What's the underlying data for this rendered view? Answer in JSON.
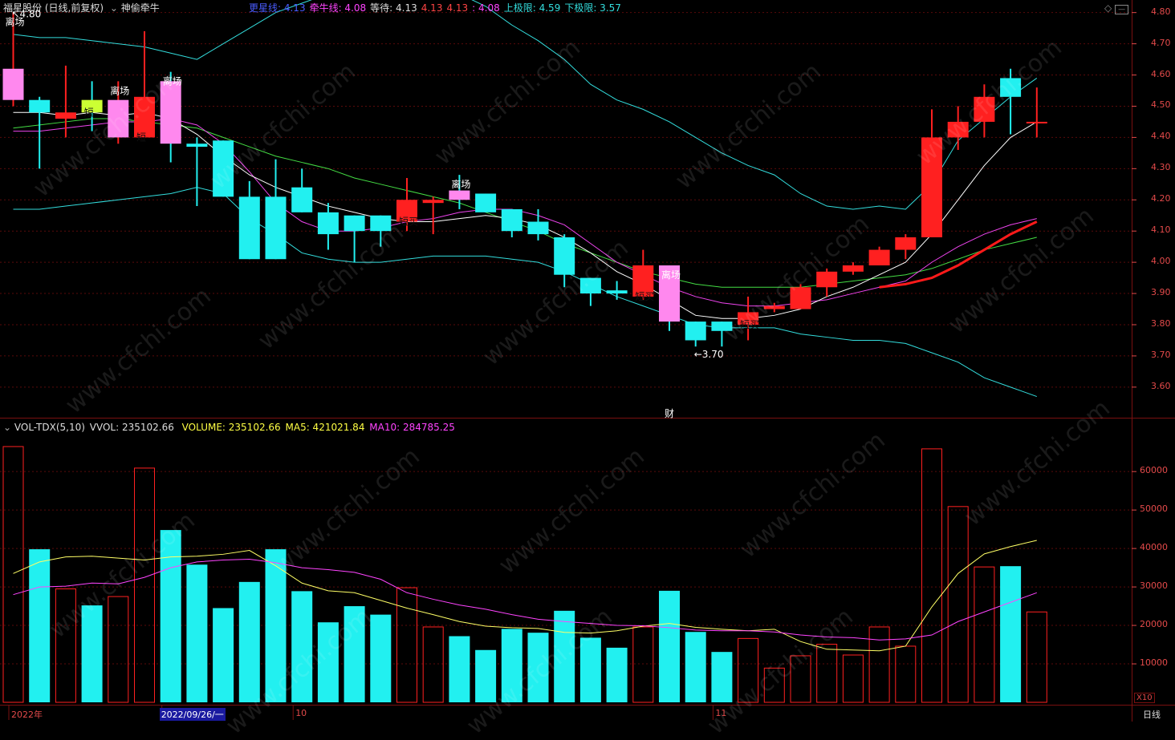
{
  "header": {
    "stock_name": "福星股份",
    "period_label": "(日线,前复权)",
    "indicator_name": "神偷牵牛",
    "items": [
      {
        "label": "更星线:",
        "value": "4.13",
        "color": "#4a5cff"
      },
      {
        "label": "牵牛线:",
        "value": "4.08",
        "color": "#ff44ff"
      },
      {
        "label": "等待:",
        "value": "4.13",
        "color": "#dddddd"
      },
      {
        "label": "",
        "value": "4.13",
        "color": "#ff4444"
      },
      {
        "label": "",
        "value": "4.13",
        "color": "#ff4444"
      },
      {
        "label": "",
        "value": ": 4.08",
        "color": "#ff44ff"
      },
      {
        "label": "上极限:",
        "value": "4.59",
        "color": "#33dddd"
      },
      {
        "label": "下极限:",
        "value": "3.57",
        "color": "#33dddd"
      }
    ]
  },
  "volume_header": {
    "name": "VOL-TDX(5,10)",
    "vvol": "VVOL: 235102.66",
    "volume": "VOLUME: 235102.66",
    "ma5": "MA5: 421021.84",
    "ma10": "MA10: 284785.25"
  },
  "colors": {
    "up": "#ff2020",
    "down": "#22f0f0",
    "ma5": "#ffff66",
    "ma10": "#ff44ff",
    "grid": "#5a0a0a",
    "axis": "#e34a4a"
  },
  "annotations": {
    "high": "4.80",
    "low": "3.70",
    "fin_mark": "财",
    "x10": "X10",
    "period_button": "日线"
  },
  "chart_data": {
    "type": "candlestick",
    "y_ticks": [
      "4.80",
      "4.70",
      "4.60",
      "4.50",
      "4.40",
      "4.30",
      "4.20",
      "4.10",
      "4.00",
      "3.90",
      "3.80",
      "3.70",
      "3.60"
    ],
    "ylim": [
      3.52,
      4.83
    ],
    "vol_ticks": [
      "60000",
      "50000",
      "40000",
      "30000",
      "20000",
      "10000"
    ],
    "vol_ylim": [
      0,
      69000
    ],
    "x_labels": [
      {
        "label": "2022年",
        "index": 0
      },
      {
        "label": "2022/09/26/一",
        "index": 6
      },
      {
        "label": "10",
        "index": 11
      },
      {
        "label": "11",
        "index": 27
      }
    ],
    "candles": [
      [
        4.52,
        4.62,
        4.8,
        4.5
      ],
      [
        4.52,
        4.48,
        4.53,
        4.3
      ],
      [
        4.46,
        4.48,
        4.63,
        4.4
      ],
      [
        4.52,
        4.48,
        4.58,
        4.42
      ],
      [
        4.4,
        4.52,
        4.58,
        4.38
      ],
      [
        4.4,
        4.53,
        4.74,
        4.4
      ],
      [
        4.58,
        4.38,
        4.61,
        4.32
      ],
      [
        4.38,
        4.37,
        4.4,
        4.18
      ],
      [
        4.39,
        4.21,
        4.39,
        4.21
      ],
      [
        4.21,
        4.01,
        4.26,
        4.01
      ],
      [
        4.21,
        4.01,
        4.33,
        4.01
      ],
      [
        4.24,
        4.16,
        4.3,
        4.16
      ],
      [
        4.16,
        4.09,
        4.19,
        4.04
      ],
      [
        4.15,
        4.1,
        4.15,
        4.0
      ],
      [
        4.15,
        4.1,
        4.15,
        4.05
      ],
      [
        4.13,
        4.2,
        4.27,
        4.1
      ],
      [
        4.19,
        4.2,
        4.21,
        4.09
      ],
      [
        4.23,
        4.2,
        4.28,
        4.17
      ],
      [
        4.22,
        4.16,
        4.22,
        4.16
      ],
      [
        4.17,
        4.1,
        4.17,
        4.08
      ],
      [
        4.13,
        4.09,
        4.17,
        4.07
      ],
      [
        4.08,
        3.96,
        4.09,
        3.92
      ],
      [
        3.95,
        3.9,
        3.95,
        3.86
      ],
      [
        3.91,
        3.9,
        3.94,
        3.88
      ],
      [
        3.89,
        3.99,
        4.04,
        3.88
      ],
      [
        3.99,
        3.81,
        3.99,
        3.78
      ],
      [
        3.81,
        3.75,
        3.81,
        3.73
      ],
      [
        3.81,
        3.78,
        3.81,
        3.73
      ],
      [
        3.8,
        3.84,
        3.89,
        3.75
      ],
      [
        3.85,
        3.86,
        3.87,
        3.84
      ],
      [
        3.85,
        3.92,
        3.93,
        3.85
      ],
      [
        3.92,
        3.97,
        3.98,
        3.89
      ],
      [
        3.97,
        3.99,
        4.0,
        3.96
      ],
      [
        3.99,
        4.04,
        4.05,
        3.99
      ],
      [
        4.04,
        4.08,
        4.09,
        4.01
      ],
      [
        4.08,
        4.4,
        4.49,
        4.08
      ],
      [
        4.4,
        4.45,
        4.5,
        4.36
      ],
      [
        4.45,
        4.53,
        4.57,
        4.4
      ],
      [
        4.59,
        4.53,
        4.62,
        4.41
      ],
      [
        4.45,
        4.45,
        4.56,
        4.4
      ]
    ],
    "volume": [
      66500,
      39800,
      29500,
      25200,
      27500,
      60900,
      44800,
      35800,
      24500,
      31300,
      39800,
      28900,
      20800,
      25000,
      22800,
      29800,
      19600,
      17200,
      13600,
      19100,
      18100,
      23800,
      16800,
      14200,
      19600,
      29000,
      18300,
      13100,
      16600,
      8900,
      12100,
      15100,
      12300,
      19600,
      14600,
      65900,
      50900,
      35200,
      35400,
      23500
    ],
    "vol_ma5": [
      33500,
      36500,
      37800,
      38000,
      37500,
      37000,
      37800,
      38000,
      38500,
      39500,
      35500,
      31000,
      29000,
      28500,
      26500,
      24500,
      22800,
      21000,
      19800,
      19400,
      19200,
      18200,
      18000,
      18600,
      19800,
      20500,
      19500,
      19000,
      18600,
      19000,
      15800,
      13800,
      13600,
      13400,
      14600,
      24800,
      33500,
      38600,
      40500,
      42100
    ],
    "vol_ma10": [
      28000,
      30000,
      30200,
      31000,
      30800,
      32500,
      35000,
      36500,
      37000,
      37200,
      36300,
      35000,
      34500,
      33800,
      32000,
      28500,
      26800,
      25300,
      24200,
      22800,
      21600,
      21000,
      20500,
      20000,
      19900,
      19400,
      18800,
      18600,
      18600,
      18300,
      17500,
      17000,
      16800,
      16200,
      16500,
      17500,
      21000,
      23500,
      26000,
      28500
    ],
    "ma_white": [
      4.48,
      4.48,
      4.47,
      4.48,
      4.47,
      4.48,
      4.46,
      4.41,
      4.34,
      4.28,
      4.24,
      4.21,
      4.18,
      4.16,
      4.14,
      4.13,
      4.13,
      4.14,
      4.15,
      4.14,
      4.12,
      4.08,
      4.03,
      3.97,
      3.93,
      3.88,
      3.83,
      3.82,
      3.82,
      3.83,
      3.85,
      3.89,
      3.92,
      3.96,
      4.0,
      4.09,
      4.2,
      4.31,
      4.4,
      4.45
    ],
    "ma_magenta": [
      4.42,
      4.42,
      4.43,
      4.44,
      4.45,
      4.45,
      4.46,
      4.44,
      4.38,
      4.29,
      4.19,
      4.13,
      4.1,
      4.1,
      4.11,
      4.13,
      4.14,
      4.16,
      4.17,
      4.17,
      4.15,
      4.12,
      4.06,
      4.0,
      3.96,
      3.92,
      3.89,
      3.87,
      3.86,
      3.86,
      3.87,
      3.88,
      3.9,
      3.92,
      3.94,
      4.0,
      4.05,
      4.09,
      4.12,
      4.14
    ],
    "upper_band": [
      4.73,
      4.72,
      4.72,
      4.71,
      4.7,
      4.69,
      4.67,
      4.65,
      4.7,
      4.75,
      4.8,
      4.83,
      4.86,
      4.88,
      4.89,
      4.89,
      4.88,
      4.86,
      4.82,
      4.76,
      4.71,
      4.65,
      4.57,
      4.52,
      4.49,
      4.45,
      4.4,
      4.35,
      4.31,
      4.28,
      4.22,
      4.18,
      4.17,
      4.18,
      4.17,
      4.25,
      4.39,
      4.46,
      4.53,
      4.59
    ],
    "lower_band": [
      4.17,
      4.17,
      4.18,
      4.19,
      4.2,
      4.21,
      4.22,
      4.24,
      4.22,
      4.14,
      4.09,
      4.03,
      4.01,
      4.0,
      4.0,
      4.01,
      4.02,
      4.02,
      4.02,
      4.01,
      4.0,
      3.97,
      3.93,
      3.89,
      3.86,
      3.83,
      3.8,
      3.79,
      3.79,
      3.79,
      3.77,
      3.76,
      3.75,
      3.75,
      3.74,
      3.71,
      3.68,
      3.63,
      3.6,
      3.57
    ],
    "ma_green": [
      4.43,
      4.44,
      4.45,
      4.46,
      4.46,
      4.45,
      4.44,
      4.43,
      4.4,
      4.37,
      4.34,
      4.32,
      4.3,
      4.27,
      4.25,
      4.23,
      4.21,
      4.19,
      4.16,
      4.13,
      4.1,
      4.06,
      4.03,
      4.0,
      3.97,
      3.95,
      3.93,
      3.92,
      3.92,
      3.92,
      3.92,
      3.93,
      3.94,
      3.95,
      3.96,
      3.98,
      4.01,
      4.04,
      4.06,
      4.08
    ],
    "red_line": [
      null,
      null,
      null,
      null,
      null,
      null,
      null,
      null,
      null,
      null,
      null,
      null,
      null,
      null,
      null,
      null,
      null,
      null,
      null,
      null,
      null,
      null,
      null,
      null,
      null,
      null,
      null,
      null,
      null,
      null,
      null,
      null,
      null,
      3.92,
      3.93,
      3.95,
      3.99,
      4.04,
      4.09,
      4.13
    ],
    "signals": [
      {
        "i": 0,
        "text": "离场",
        "kind": "exit"
      },
      {
        "i": 4,
        "text": "离场",
        "kind": "exit"
      },
      {
        "i": 6,
        "text": "离场",
        "kind": "exit"
      },
      {
        "i": 17,
        "text": "离场",
        "kind": "exit"
      },
      {
        "i": 25,
        "text": "离场",
        "kind": "exit"
      },
      {
        "i": 3,
        "text": "短",
        "kind": "buy"
      },
      {
        "i": 5,
        "text": "短",
        "kind": "buy"
      },
      {
        "i": 15,
        "text": "短买",
        "kind": "buy"
      },
      {
        "i": 24,
        "text": "短买",
        "kind": "buy"
      },
      {
        "i": 28,
        "text": "短买",
        "kind": "buy"
      }
    ]
  }
}
